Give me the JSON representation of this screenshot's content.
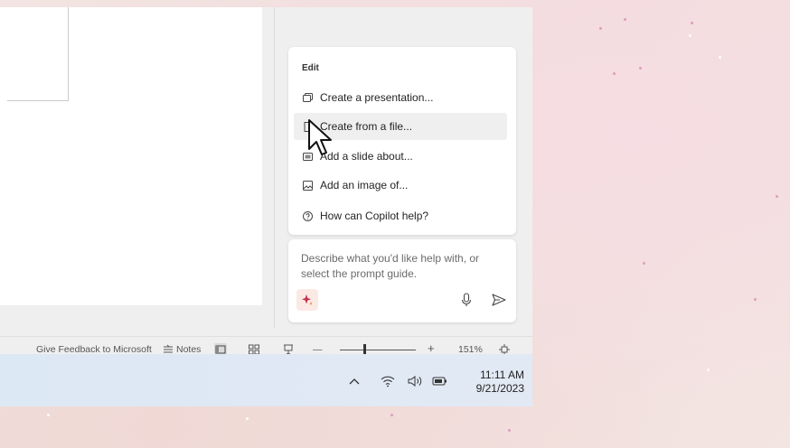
{
  "copilot": {
    "menu": {
      "heading": "Edit",
      "items": [
        {
          "label": "Create a presentation...",
          "icon": "presentation-icon"
        },
        {
          "label": "Create from a file...",
          "icon": "file-icon"
        },
        {
          "label": "Add a slide about...",
          "icon": "slide-icon"
        },
        {
          "label": "Add an image of...",
          "icon": "image-icon"
        },
        {
          "label": "How can Copilot help?",
          "icon": "help-icon"
        }
      ],
      "hovered_index": 1
    },
    "prompt": {
      "placeholder": "Describe what you'd like help with, or select the prompt guide.",
      "guide_icon": "sparkle-icon",
      "mic_icon": "microphone-icon",
      "send_icon": "send-icon"
    }
  },
  "status_bar": {
    "feedback": "Give Feedback to Microsoft",
    "notes": "Notes",
    "zoom_minus": "—",
    "zoom_plus": "+",
    "zoom_level": "151%",
    "zoom_fraction": 0.32
  },
  "taskbar": {
    "time": "11:11 AM",
    "date": "9/21/2023"
  },
  "colors": {
    "accent": "#c4314b",
    "menu_hover": "#efefef",
    "taskbar": "#dde8f5"
  }
}
